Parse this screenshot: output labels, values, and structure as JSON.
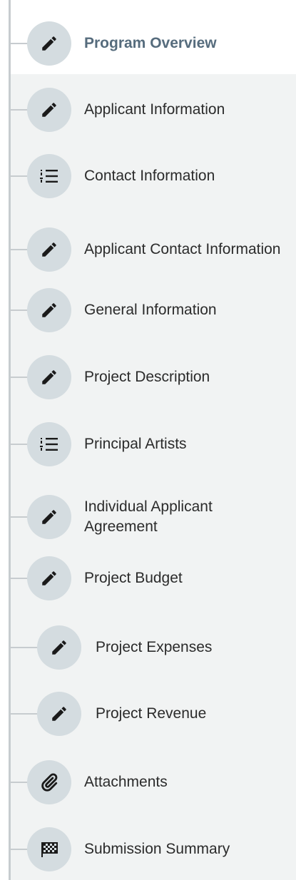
{
  "nav": {
    "items": [
      {
        "label": "Program Overview",
        "icon": "pencil-icon",
        "active": true
      },
      {
        "label": "Applicant Information",
        "icon": "pencil-icon"
      },
      {
        "label": "Contact Information",
        "icon": "list-icon"
      },
      {
        "label": "Applicant Contact Information",
        "icon": "pencil-icon"
      },
      {
        "label": "General Information",
        "icon": "pencil-icon"
      },
      {
        "label": "Project Description",
        "icon": "pencil-icon"
      },
      {
        "label": "Principal Artists",
        "icon": "list-icon"
      },
      {
        "label": "Individual Applicant Agreement",
        "icon": "pencil-icon"
      },
      {
        "label": "Project Budget",
        "icon": "pencil-icon"
      },
      {
        "label": "Project Expenses",
        "icon": "pencil-icon"
      },
      {
        "label": "Project Revenue",
        "icon": "pencil-icon"
      },
      {
        "label": "Attachments",
        "icon": "paperclip-icon"
      },
      {
        "label": "Submission Summary",
        "icon": "flag-icon"
      }
    ]
  },
  "colors": {
    "active_text": "#566c7d",
    "text": "#2b2b2b",
    "circle": "#d4dce0",
    "panel": "#f1f3f3",
    "spine": "#c7cccf"
  }
}
